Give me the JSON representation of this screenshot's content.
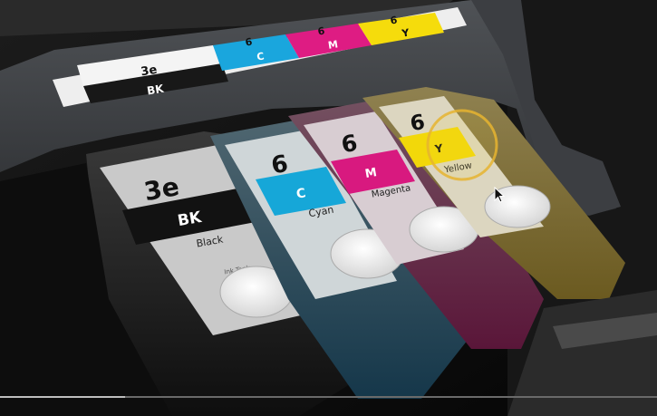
{
  "holder_labels": {
    "bk_number": "3e",
    "bk_color": "BK",
    "c_number": "6",
    "c_color": "C",
    "m_number": "6",
    "m_color": "M",
    "y_number": "6",
    "y_color": "Y"
  },
  "cartridges": {
    "black": {
      "number": "3e",
      "code": "BK",
      "name": "Black",
      "small_print": "Ink Tank"
    },
    "cyan": {
      "number": "6",
      "code": "C",
      "name": "Cyan"
    },
    "magenta": {
      "number": "6",
      "code": "M",
      "name": "Magenta"
    },
    "yellow": {
      "number": "6",
      "code": "Y",
      "name": "Yellow"
    }
  },
  "colors": {
    "black_ink": "#1a1a1a",
    "cyan_ink": "#16a7d8",
    "magenta_ink": "#d8197f",
    "yellow_ink": "#f2d80a",
    "highlight_ring": "#e6b430"
  },
  "video": {
    "progress": 0.19
  }
}
